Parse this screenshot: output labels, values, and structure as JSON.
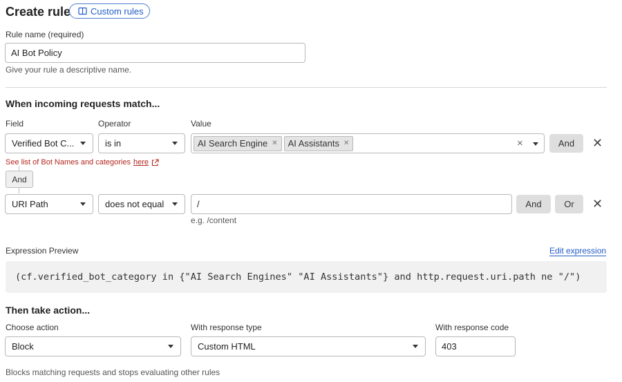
{
  "header": {
    "title": "Create rule",
    "custom_rules_label": "Custom rules",
    "custom_rules_icon": "book-icon"
  },
  "rule_name": {
    "label": "Rule name (required)",
    "value": "AI Bot Policy",
    "help": "Give your rule a descriptive name."
  },
  "match": {
    "heading": "When incoming requests match...",
    "field_header": "Field",
    "operator_header": "Operator",
    "value_header": "Value",
    "row1": {
      "field": "Verified Bot C...",
      "operator": "is in",
      "chips": [
        "AI Search Engine",
        "AI Assistants"
      ],
      "and_label": "And",
      "bot_link_text": "See list of Bot Names and categories",
      "bot_link_here": "here"
    },
    "connector_label": "And",
    "row2": {
      "field": "URI Path",
      "operator": "does not equal",
      "value": "/",
      "hint": "e.g. /content",
      "and_label": "And",
      "or_label": "Or"
    }
  },
  "expression": {
    "label": "Expression Preview",
    "edit_label": "Edit expression",
    "text": "(cf.verified_bot_category in {\"AI Search Engines\" \"AI Assistants\"} and http.request.uri.path ne \"/\")"
  },
  "action": {
    "heading": "Then take action...",
    "choose_label": "Choose action",
    "choose_value": "Block",
    "response_type_label": "With response type",
    "response_type_value": "Custom HTML",
    "response_code_label": "With response code",
    "response_code_value": "403",
    "description": "Blocks matching requests and stops evaluating other rules"
  },
  "colors": {
    "link_blue": "#1f5bc4",
    "link_red": "#b3261e",
    "button_gray": "#dedede"
  }
}
